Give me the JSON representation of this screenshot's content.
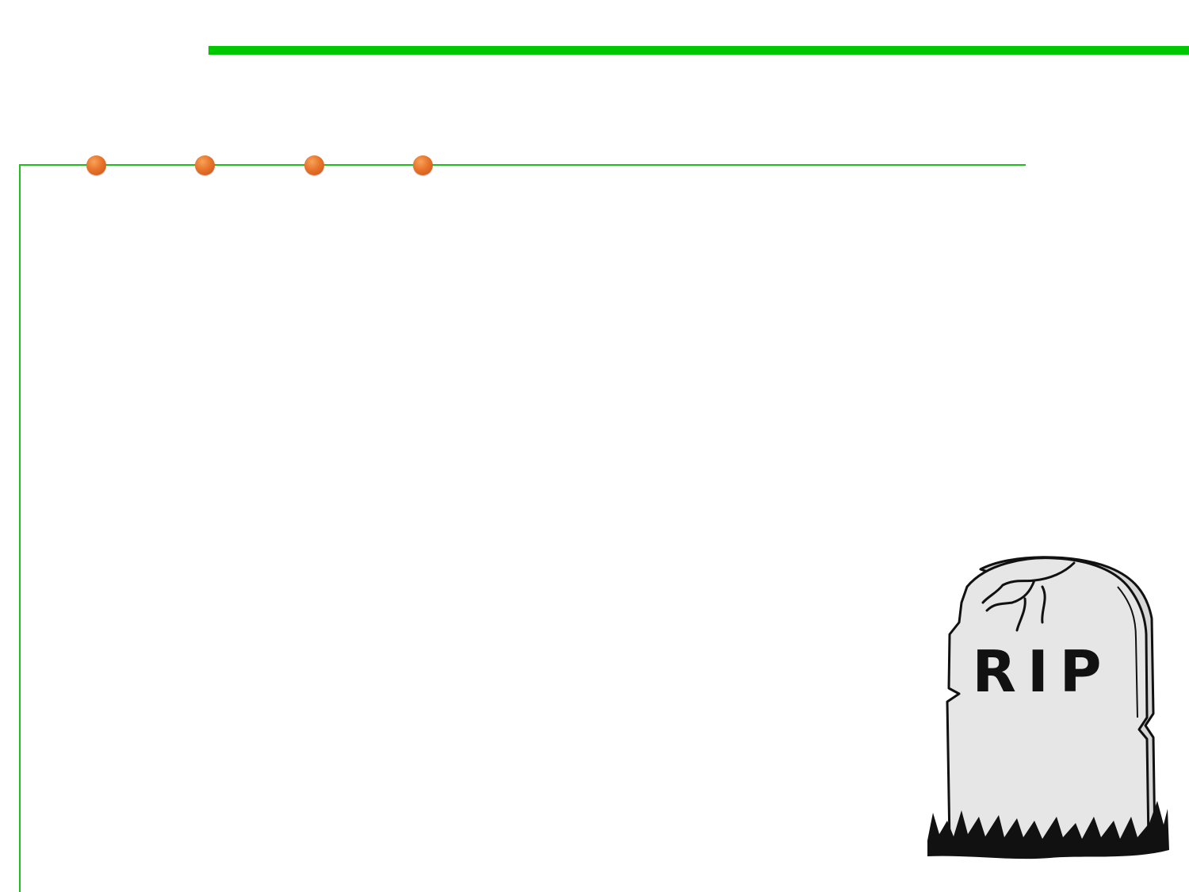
{
  "slide": {
    "accent_color": "#00c800",
    "frame_color": "#1fbf1f",
    "bullet_color": "#e8742a",
    "bullets": [
      "bullet-1",
      "bullet-2",
      "bullet-3",
      "bullet-4"
    ]
  },
  "tombstone": {
    "icon": "tombstone-icon",
    "inscription": "RIP"
  }
}
